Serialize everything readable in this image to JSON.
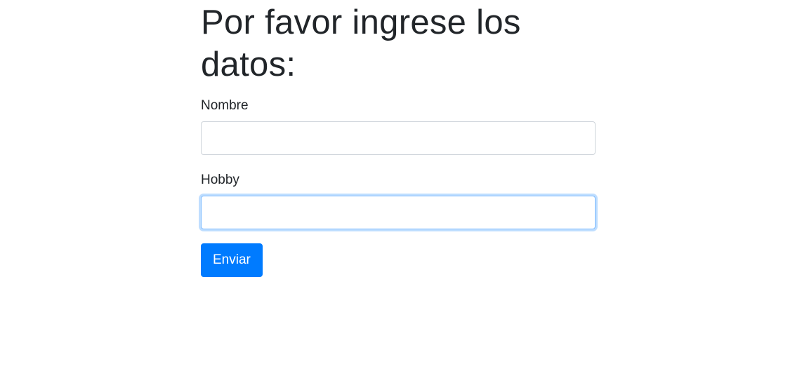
{
  "form": {
    "title": "Por favor ingrese los datos:",
    "fields": [
      {
        "label": "Nombre",
        "value": "",
        "focused": false
      },
      {
        "label": "Hobby",
        "value": "",
        "focused": true
      }
    ],
    "submit_label": "Enviar"
  },
  "colors": {
    "primary": "#007bff",
    "text": "#212529",
    "input_border": "#ced4da",
    "focus_border": "#80bdff"
  }
}
